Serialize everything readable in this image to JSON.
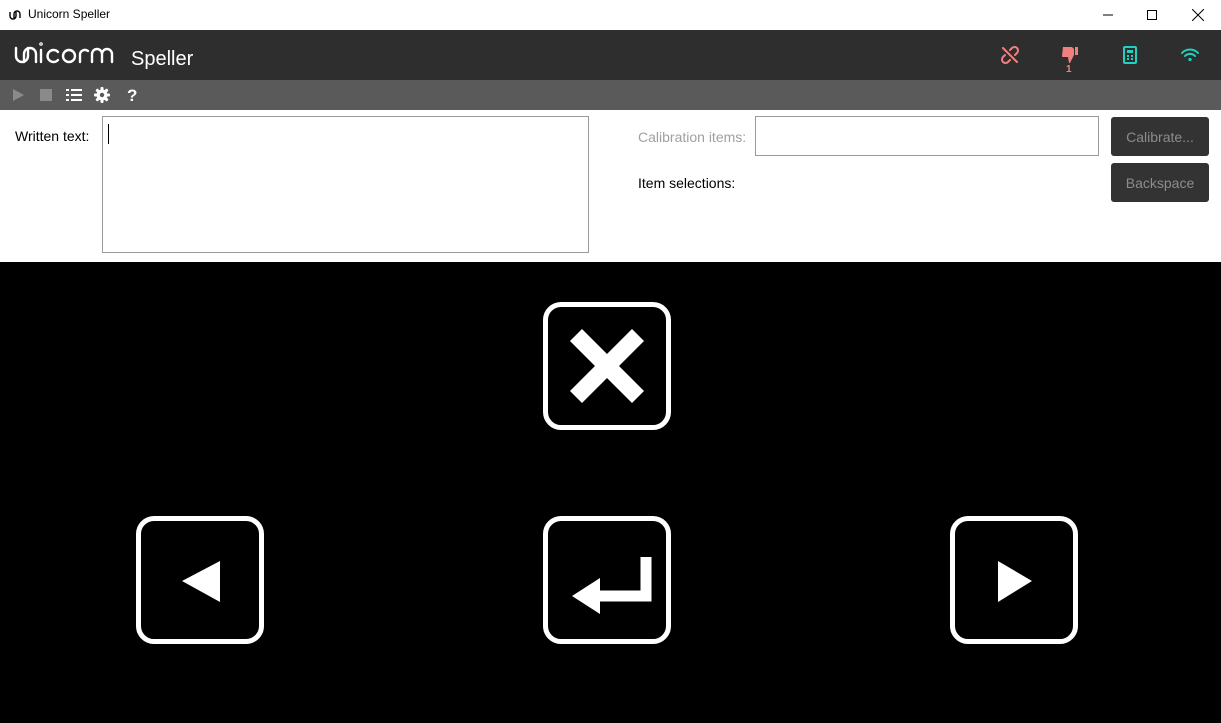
{
  "window": {
    "title": "Unicorn Speller",
    "controls": [
      "minimize",
      "maximize",
      "close"
    ]
  },
  "header": {
    "brand_logo_text": "unicorn",
    "brand_sub": "Speller",
    "status": {
      "artifact_badge": "1",
      "colors": {
        "error": "#f08080",
        "ok": "#20d0c0"
      }
    }
  },
  "toolbar": {
    "items": [
      "play-icon",
      "stop-icon",
      "list-icon",
      "gear-icon",
      "help-icon"
    ]
  },
  "form": {
    "written_text_label": "Written text:",
    "written_text_value": "",
    "calibration_items_label": "Calibration items:",
    "calibration_items_value": "",
    "item_selections_label": "Item selections:",
    "calibrate_button": "Calibrate...",
    "backspace_button": "Backspace"
  },
  "speller": {
    "keys": [
      "delete-key",
      "left-key",
      "enter-key",
      "right-key"
    ]
  }
}
